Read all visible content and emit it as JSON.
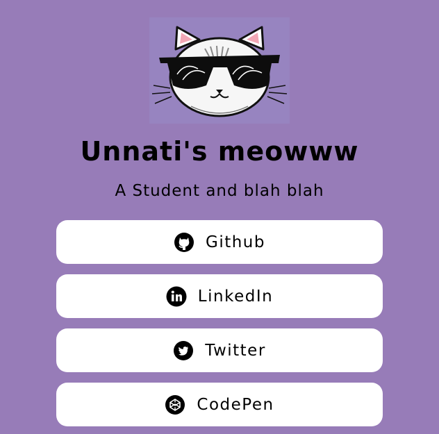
{
  "profile": {
    "title": "Unnati's meowww",
    "subtitle": "A Student and blah blah"
  },
  "links": [
    {
      "label": "Github",
      "icon": "github-icon"
    },
    {
      "label": "LinkedIn",
      "icon": "linkedin-icon"
    },
    {
      "label": "Twitter",
      "icon": "twitter-icon"
    },
    {
      "label": "CodePen",
      "icon": "codepen-icon"
    }
  ],
  "colors": {
    "background": "#977cb8",
    "button": "#ffffff",
    "text": "#000000"
  }
}
